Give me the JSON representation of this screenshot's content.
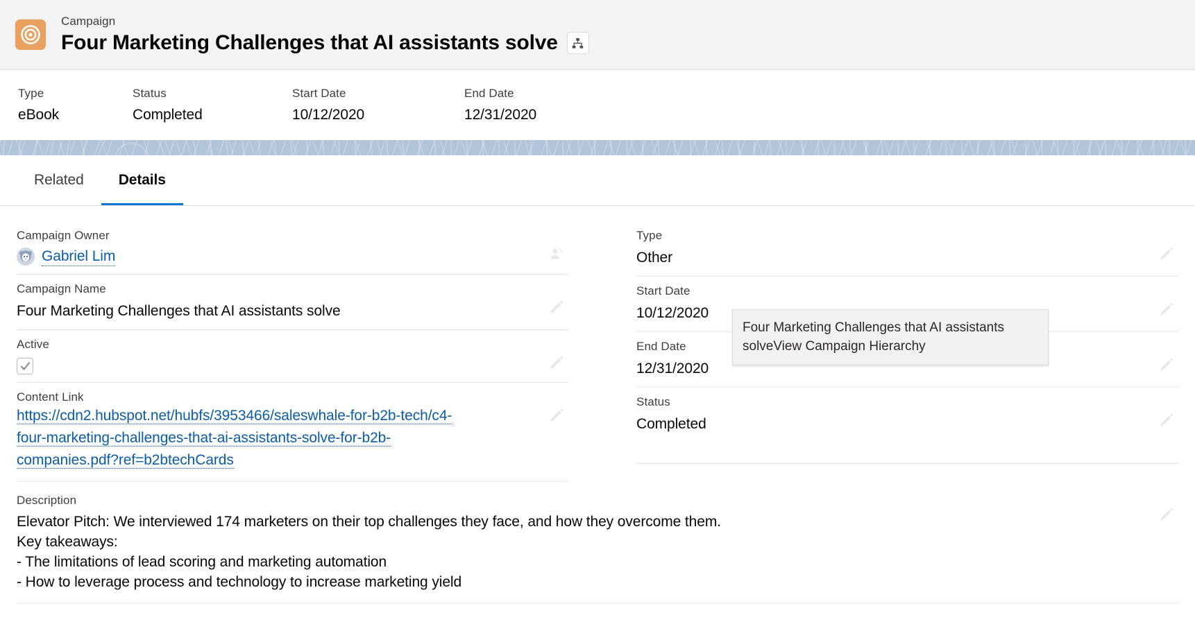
{
  "header": {
    "entity_label": "Campaign",
    "record_title": "Four Marketing Challenges that AI assistants solve",
    "entity_icon": "campaign-target-icon",
    "hierarchy_icon": "hierarchy-tree-icon",
    "icon_color": "#e8a15f"
  },
  "highlights": [
    {
      "label": "Type",
      "value": "eBook"
    },
    {
      "label": "Status",
      "value": "Completed"
    },
    {
      "label": "Start Date",
      "value": "10/12/2020"
    },
    {
      "label": "End Date",
      "value": "12/31/2020"
    }
  ],
  "tabs": [
    {
      "label": "Related",
      "active": false
    },
    {
      "label": "Details",
      "active": true
    }
  ],
  "details": {
    "left": [
      {
        "label": "Campaign Owner",
        "value": "Gabriel Lim",
        "kind": "owner",
        "action_icon": "change-owner-icon"
      },
      {
        "label": "Campaign Name",
        "value": "Four Marketing Challenges that AI assistants solve",
        "kind": "text",
        "action_icon": "edit-pencil-icon"
      },
      {
        "label": "Active",
        "value": "",
        "kind": "checkbox",
        "checked": true,
        "action_icon": "edit-pencil-icon"
      },
      {
        "label": "Content Link",
        "value": "https://cdn2.hubspot.net/hubfs/3953466/saleswhale-for-b2b-tech/c4-four-marketing-challenges-that-ai-assistants-solve-for-b2b-companies.pdf?ref=b2btechCards",
        "kind": "url",
        "action_icon": "edit-pencil-icon"
      }
    ],
    "right": [
      {
        "label": "Type",
        "value": "Other",
        "kind": "text",
        "action_icon": "edit-pencil-icon"
      },
      {
        "label": "Start Date",
        "value": "10/12/2020",
        "kind": "text",
        "action_icon": "edit-pencil-icon"
      },
      {
        "label": "End Date",
        "value": "12/31/2020",
        "kind": "text",
        "action_icon": "edit-pencil-icon"
      },
      {
        "label": "Status",
        "value": "Completed",
        "kind": "text",
        "action_icon": "edit-pencil-icon"
      }
    ],
    "description": {
      "label": "Description",
      "lines": [
        "Elevator Pitch: We interviewed 174 marketers on their top challenges they face, and how they overcome them.",
        "Key takeaways:",
        "- The limitations of lead scoring and marketing automation",
        "- How to leverage process and technology to increase marketing yield"
      ],
      "action_icon": "edit-pencil-icon"
    }
  },
  "tooltip": {
    "text": "Four Marketing Challenges that AI assistants solveView Campaign Hierarchy"
  },
  "colors": {
    "link": "#0b5cab",
    "tab_active_underline": "#0176d3",
    "band": "#b3c3da",
    "header_bg": "#f3f3f3"
  }
}
